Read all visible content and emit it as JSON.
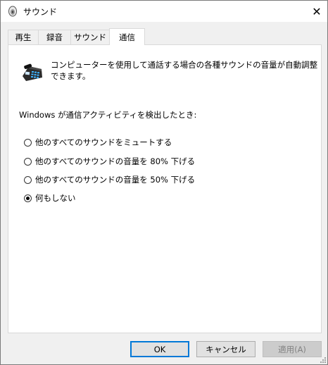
{
  "window": {
    "title": "サウンド",
    "icon": "speaker-icon",
    "close_glyph": "✕"
  },
  "tabs": [
    {
      "label": "再生",
      "active": false
    },
    {
      "label": "録音",
      "active": false
    },
    {
      "label": "サウンド",
      "active": false
    },
    {
      "label": "通信",
      "active": true
    }
  ],
  "panel": {
    "icon": "telephone-icon",
    "description": "コンピューターを使用して通話する場合の各種サウンドの音量が自動調整できます。",
    "detect_label": "Windows が通信アクティビティを検出したとき:",
    "options": [
      {
        "label": "他のすべてのサウンドをミュートする",
        "checked": false
      },
      {
        "label": "他のすべてのサウンドの音量を 80% 下げる",
        "checked": false
      },
      {
        "label": "他のすべてのサウンドの音量を 50% 下げる",
        "checked": false
      },
      {
        "label": "何もしない",
        "checked": true
      }
    ]
  },
  "buttons": {
    "ok": "OK",
    "cancel": "キャンセル",
    "apply": "適用(A)"
  },
  "colors": {
    "accent": "#0078d7",
    "window_bg": "#f0f0f0",
    "panel_bg": "#ffffff"
  }
}
